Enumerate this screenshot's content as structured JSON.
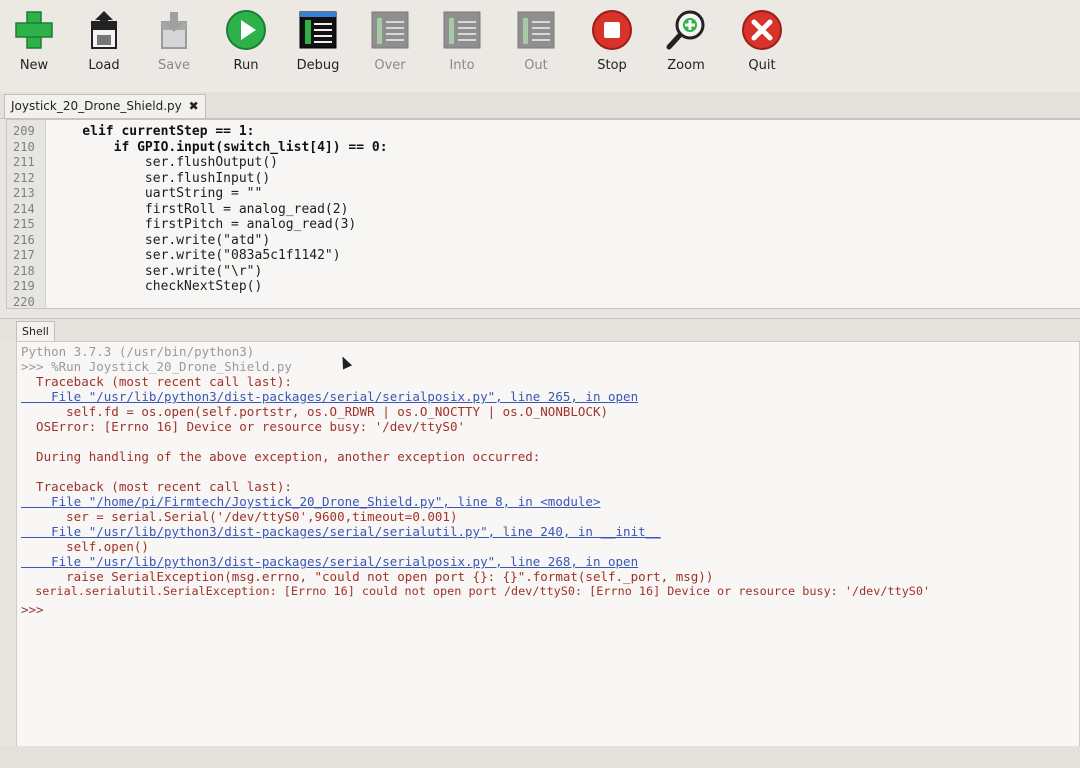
{
  "toolbar": {
    "buttons": [
      {
        "label": "New",
        "icon": "plus-icon",
        "enabled": true
      },
      {
        "label": "Load",
        "icon": "open-file-icon",
        "enabled": true
      },
      {
        "label": "Save",
        "icon": "save-icon",
        "enabled": false
      },
      {
        "label": "Run",
        "icon": "play-icon",
        "enabled": true
      },
      {
        "label": "Debug",
        "icon": "debug-icon",
        "enabled": true
      },
      {
        "label": "Over",
        "icon": "step-over-icon",
        "enabled": false
      },
      {
        "label": "Into",
        "icon": "step-into-icon",
        "enabled": false
      },
      {
        "label": "Out",
        "icon": "step-out-icon",
        "enabled": false
      },
      {
        "label": "Stop",
        "icon": "stop-icon",
        "enabled": true
      },
      {
        "label": "Zoom",
        "icon": "zoom-icon",
        "enabled": true
      },
      {
        "label": "Quit",
        "icon": "quit-icon",
        "enabled": true
      }
    ],
    "colors": {
      "green": "#2db24a",
      "red": "#d8322a",
      "dark": "#222222"
    }
  },
  "editor": {
    "tab_title": "Joystick_20_Drone_Shield.py",
    "close_glyph": "✖",
    "lines": [
      {
        "n": "209",
        "text": "    elif currentStep == 1:"
      },
      {
        "n": "210",
        "text": "        if GPIO.input(switch_list[4]) == 0:"
      },
      {
        "n": "211",
        "text": "            ser.flushOutput()"
      },
      {
        "n": "212",
        "text": "            ser.flushInput()"
      },
      {
        "n": "213",
        "text": "            uartString = \"\""
      },
      {
        "n": "214",
        "text": "            firstRoll = analog_read(2)"
      },
      {
        "n": "215",
        "text": "            firstPitch = analog_read(3)"
      },
      {
        "n": "216",
        "text": "            ser.write(\"atd\")"
      },
      {
        "n": "217",
        "text": "            ser.write(\"083a5c1f1142\")"
      },
      {
        "n": "218",
        "text": "            ser.write(\"\\r\")"
      },
      {
        "n": "219",
        "text": "            checkNextStep()"
      },
      {
        "n": "220",
        "text": ""
      }
    ]
  },
  "shell": {
    "tab_title": "Shell",
    "lines": [
      {
        "text": "Python 3.7.3 (/usr/bin/python3)",
        "style": "grey"
      },
      {
        "text": ">>> %Run Joystick_20_Drone_Shield.py",
        "style": "grey"
      },
      {
        "text": "  Traceback (most recent call last):",
        "style": "red"
      },
      {
        "text": "    File \"/usr/lib/python3/dist-packages/serial/serialposix.py\", line 265, in open",
        "style": "link"
      },
      {
        "text": "      self.fd = os.open(self.portstr, os.O_RDWR | os.O_NOCTTY | os.O_NONBLOCK)",
        "style": "red"
      },
      {
        "text": "  OSError: [Errno 16] Device or resource busy: '/dev/ttyS0'",
        "style": "red"
      },
      {
        "text": "",
        "style": "red"
      },
      {
        "text": "  During handling of the above exception, another exception occurred:",
        "style": "red"
      },
      {
        "text": "",
        "style": "red"
      },
      {
        "text": "  Traceback (most recent call last):",
        "style": "red"
      },
      {
        "text": "    File \"/home/pi/Firmtech/Joystick_20_Drone_Shield.py\", line 8, in <module>",
        "style": "link"
      },
      {
        "text": "      ser = serial.Serial('/dev/ttyS0',9600,timeout=0.001)",
        "style": "red"
      },
      {
        "text": "    File \"/usr/lib/python3/dist-packages/serial/serialutil.py\", line 240, in __init__",
        "style": "link"
      },
      {
        "text": "      self.open()",
        "style": "red"
      },
      {
        "text": "    File \"/usr/lib/python3/dist-packages/serial/serialposix.py\", line 268, in open",
        "style": "link"
      },
      {
        "text": "      raise SerialException(msg.errno, \"could not open port {}: {}\".format(self._port, msg))",
        "style": "red"
      },
      {
        "text": "  serial.serialutil.SerialException: [Errno 16] could not open port /dev/ttyS0: [Errno 16] Device or resource busy: '/dev/ttyS0'",
        "style": "red"
      },
      {
        "text": "",
        "style": "red"
      },
      {
        "text": ">>>",
        "style": "prompt"
      }
    ]
  }
}
